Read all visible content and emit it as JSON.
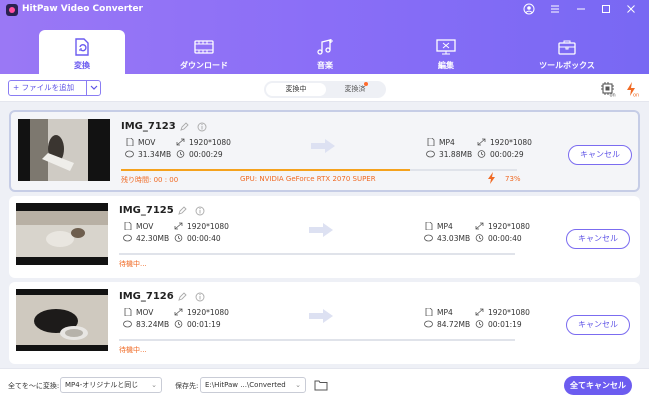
{
  "app": {
    "title": "HitPaw Video Converter"
  },
  "nav": {
    "tabs": [
      {
        "label": "変換",
        "icon": "convert-icon",
        "active": true
      },
      {
        "label": "ダウンロード",
        "icon": "film-download-icon",
        "active": false
      },
      {
        "label": "音楽",
        "icon": "music-add-icon",
        "active": false
      },
      {
        "label": "編集",
        "icon": "edit-screen-icon",
        "active": false
      },
      {
        "label": "ツールボックス",
        "icon": "toolbox-icon",
        "active": false
      }
    ]
  },
  "toolbar": {
    "add_file_label": "+ ファイルを追加",
    "segment": {
      "converting": "変換中",
      "converted": "変換済"
    },
    "hw_accel_badge": "on",
    "turbo_badge": "on"
  },
  "files": [
    {
      "name": "IMG_7123",
      "src": {
        "format": "MOV",
        "resolution": "1920*1080",
        "size": "31.34MB",
        "duration": "00:00:29"
      },
      "dst": {
        "format": "MP4",
        "resolution": "1920*1080",
        "size": "31.88MB",
        "duration": "00:00:29"
      },
      "progress": 0.73,
      "status": "残り時間: 00 : 00",
      "gpu": "GPU: NVIDIA GeForce RTX 2070 SUPER",
      "percent": "73%",
      "cancel_label": "キャンセル"
    },
    {
      "name": "IMG_7125",
      "src": {
        "format": "MOV",
        "resolution": "1920*1080",
        "size": "42.30MB",
        "duration": "00:00:40"
      },
      "dst": {
        "format": "MP4",
        "resolution": "1920*1080",
        "size": "43.03MB",
        "duration": "00:00:40"
      },
      "progress": 0,
      "status": "待機中...",
      "cancel_label": "キャンセル"
    },
    {
      "name": "IMG_7126",
      "src": {
        "format": "MOV",
        "resolution": "1920*1080",
        "size": "83.24MB",
        "duration": "00:01:19"
      },
      "dst": {
        "format": "MP4",
        "resolution": "1920*1080",
        "size": "84.72MB",
        "duration": "00:01:19"
      },
      "progress": 0,
      "status": "待機中...",
      "cancel_label": "キャンセル"
    }
  ],
  "footer": {
    "convert_all_label": "全てを～に変換:",
    "convert_all_value": "MP4-オリジナルと同じ",
    "save_label": "保存先:",
    "save_value": "E:\\HitPaw ...\\Converted",
    "cancel_all_label": "全てキャンセル"
  },
  "colors": {
    "accent": "#6c5cf0",
    "progress": "#f5a21e",
    "warning": "#f06a24"
  }
}
